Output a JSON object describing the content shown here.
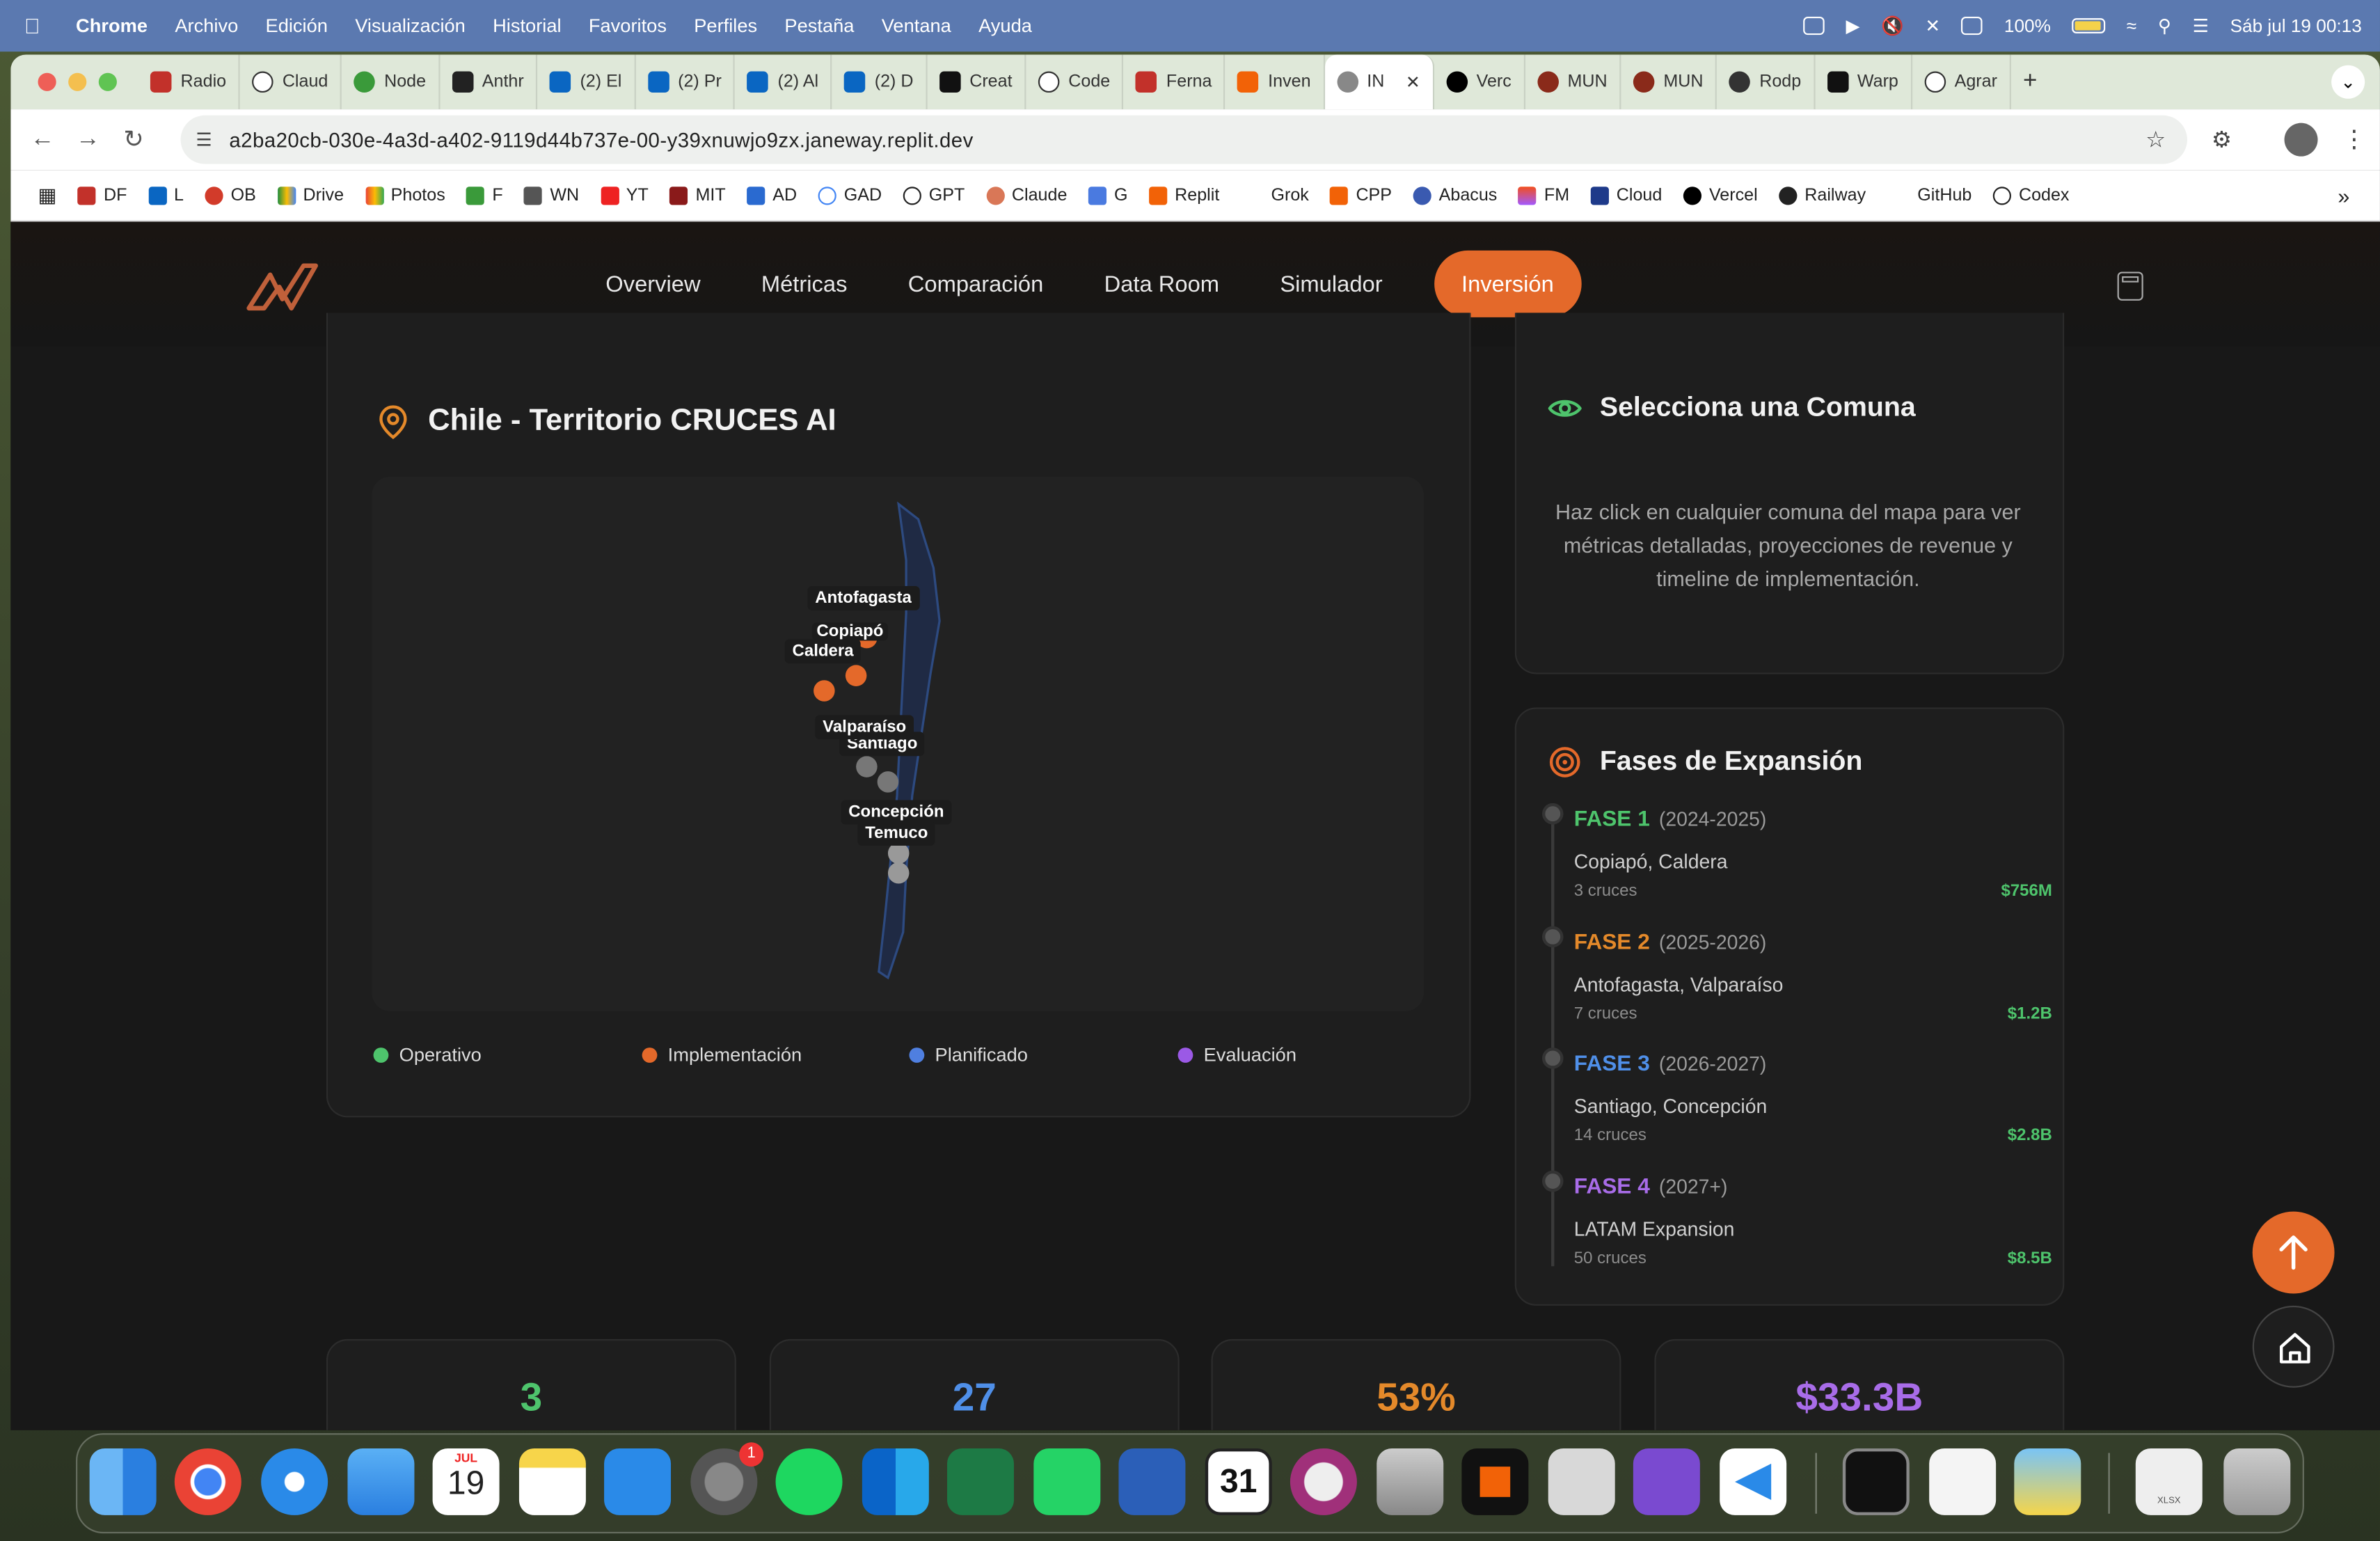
{
  "menubar": {
    "app": "Chrome",
    "items": [
      "Archivo",
      "Edición",
      "Visualización",
      "Historial",
      "Favoritos",
      "Perfiles",
      "Pestaña",
      "Ventana",
      "Ayuda"
    ],
    "battery": "100%",
    "datetime": "Sáb jul 19  00:13"
  },
  "tabs": [
    "Radio",
    "Claud",
    "Node",
    "Anthr",
    "(2) El",
    "(2) Pr",
    "(2) Al",
    "(2) D",
    "Creat",
    "Code",
    "Ferna",
    "Inven",
    "IN",
    "Verc",
    "MUN",
    "MUN",
    "Rodp",
    "Warp",
    "Agrar"
  ],
  "address": {
    "url": "a2ba20cb-030e-4a3d-a402-9119d44b737e-00-y39xnuwjo9zx.janeway.replit.dev"
  },
  "bookmarks": [
    "DF",
    "L",
    "OB",
    "Drive",
    "Photos",
    "F",
    "WN",
    "YT",
    "MIT",
    "AD",
    "GAD",
    "GPT",
    "Claude",
    "G",
    "Replit",
    "Grok",
    "CPP",
    "Abacus",
    "FM",
    "Cloud",
    "Vercel",
    "Railway",
    "GitHub",
    "Codex"
  ],
  "nav": {
    "links": [
      "Overview",
      "Métricas",
      "Comparación",
      "Data Room",
      "Simulador"
    ],
    "active": "Inversión"
  },
  "map": {
    "title": "Chile - Territorio CRUCES AI",
    "labels": {
      "antofagasta": "Antofagasta",
      "copiapo": "Copiapó",
      "caldera": "Caldera",
      "valparaiso": "Valparaíso",
      "santiago": "Santiago",
      "concepcion": "Concepción",
      "temuco": "Temuco"
    },
    "legend": [
      {
        "label": "Operativo",
        "color": "#4ec46c"
      },
      {
        "label": "Implementación",
        "color": "#e4692a"
      },
      {
        "label": "Planificado",
        "color": "#4f7fe0"
      },
      {
        "label": "Evaluación",
        "color": "#9b59e6"
      }
    ]
  },
  "select": {
    "title": "Selecciona una Comuna",
    "text": "Haz click en cualquier comuna del mapa para ver métricas detalladas, proyecciones de revenue y timeline de implementación."
  },
  "phases": {
    "title": "Fases de Expansión",
    "items": [
      {
        "name": "FASE 1",
        "years": "(2024-2025)",
        "cities": "Copiapó, Caldera",
        "cruces": "3 cruces",
        "value": "$756M",
        "color": "#4ec46c"
      },
      {
        "name": "FASE 2",
        "years": "(2025-2026)",
        "cities": "Antofagasta, Valparaíso",
        "cruces": "7 cruces",
        "value": "$1.2B",
        "color": "#e4892a"
      },
      {
        "name": "FASE 3",
        "years": "(2026-2027)",
        "cities": "Santiago, Concepción",
        "cruces": "14 cruces",
        "value": "$2.8B",
        "color": "#4f8fe8"
      },
      {
        "name": "FASE 4",
        "years": "(2027+)",
        "cities": "LATAM Expansion",
        "cruces": "50 cruces",
        "value": "$8.5B",
        "color": "#a86ce8"
      }
    ]
  },
  "stats": [
    {
      "value": "3",
      "color": "#4ec46c"
    },
    {
      "value": "27",
      "color": "#4f8fe8"
    },
    {
      "value": "53%",
      "color": "#e4892a"
    },
    {
      "value": "$33.3B",
      "color": "#a86ce8"
    }
  ],
  "dock": {
    "calendar_month": "JUL",
    "calendar_day": "19",
    "badge": "1",
    "fantastical_day": "31",
    "xlsx_label": "XLSX"
  }
}
